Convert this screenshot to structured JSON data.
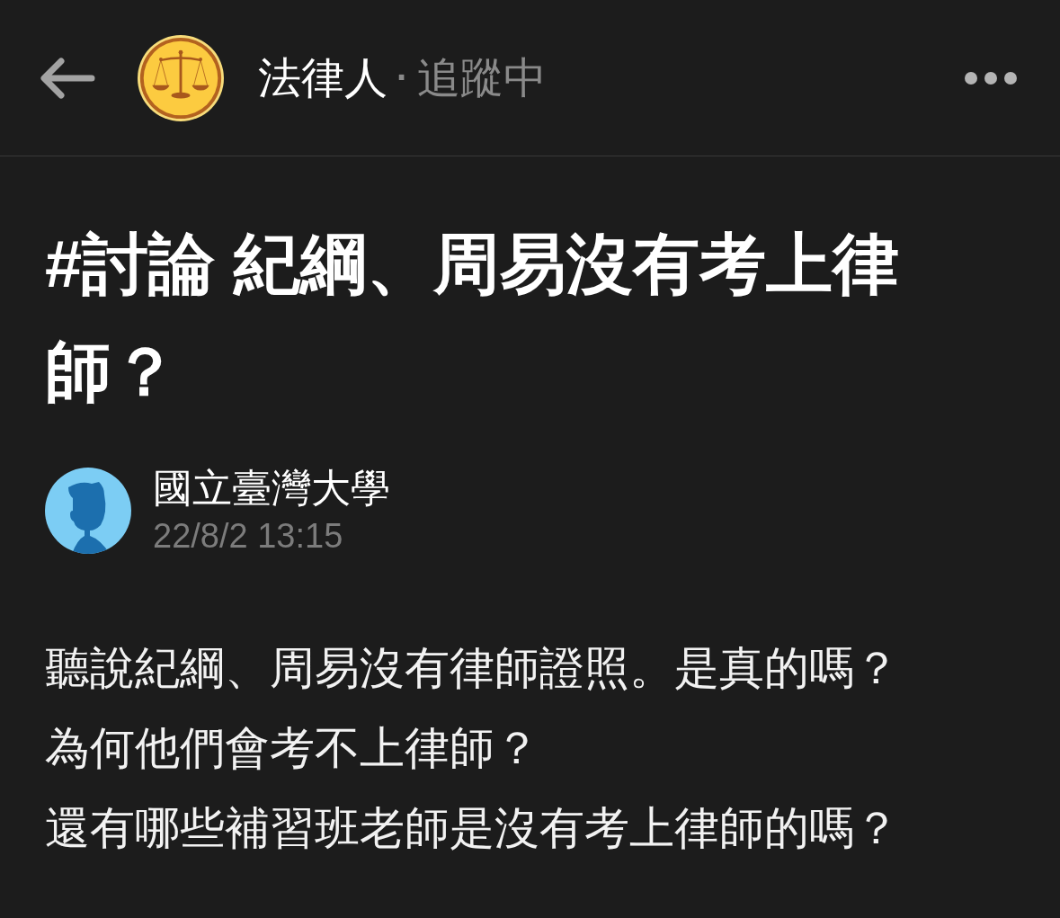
{
  "header": {
    "board_name": "法律人",
    "separator": "·",
    "follow_status": "追蹤中"
  },
  "post": {
    "title": "#討論 紀綱、周易沒有考上律師？",
    "author": {
      "name": "國立臺灣大學",
      "time": "22/8/2 13:15"
    },
    "body": [
      "聽說紀綱、周易沒有律師證照。是真的嗎？",
      "為何他們會考不上律師？",
      "還有哪些補習班老師是沒有考上律師的嗎？"
    ]
  }
}
